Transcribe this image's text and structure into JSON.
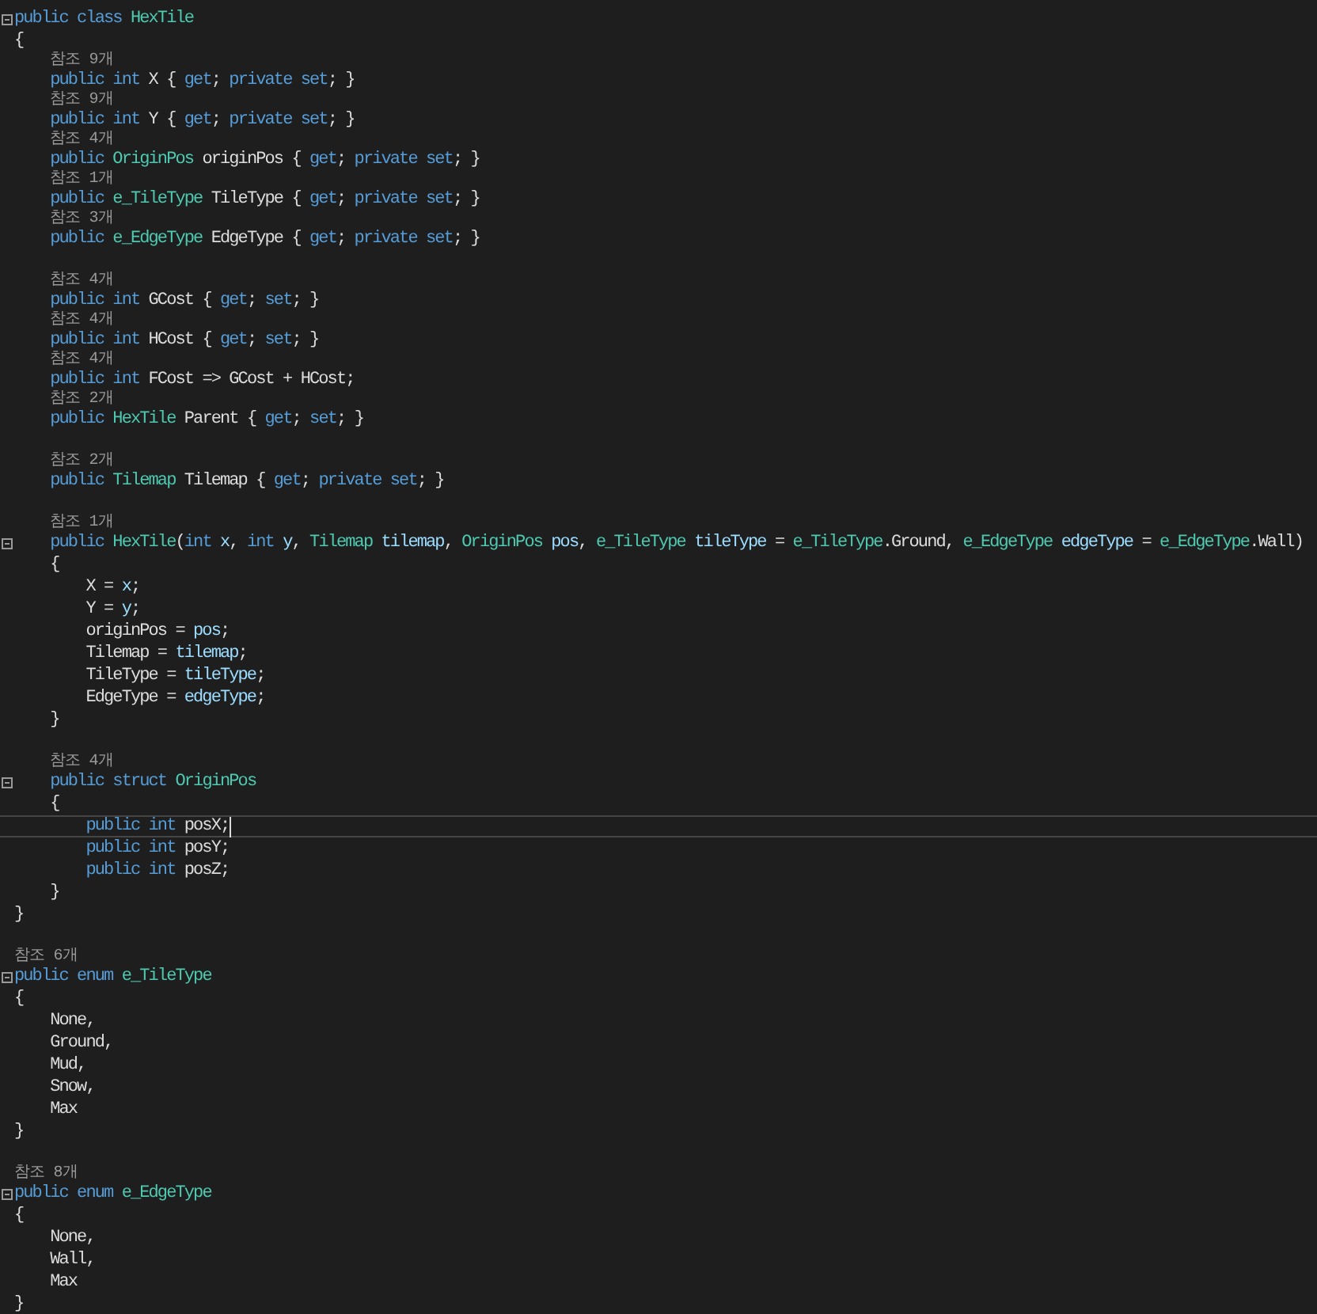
{
  "lines": [
    {
      "kind": "code",
      "fold": true,
      "tokens": [
        {
          "kind": "keyword",
          "text": "public class "
        },
        {
          "kind": "type",
          "text": "HexTile"
        }
      ]
    },
    {
      "kind": "code",
      "tokens": [
        {
          "kind": "plain",
          "text": "{"
        }
      ]
    },
    {
      "kind": "lens",
      "text": "    참조 9개"
    },
    {
      "kind": "code",
      "tokens": [
        {
          "kind": "keyword",
          "text": "    public int "
        },
        {
          "kind": "plain",
          "text": "X { "
        },
        {
          "kind": "keyword",
          "text": "get"
        },
        {
          "kind": "plain",
          "text": "; "
        },
        {
          "kind": "keyword",
          "text": "private set"
        },
        {
          "kind": "plain",
          "text": "; }"
        }
      ]
    },
    {
      "kind": "lens",
      "text": "    참조 9개"
    },
    {
      "kind": "code",
      "tokens": [
        {
          "kind": "keyword",
          "text": "    public int "
        },
        {
          "kind": "plain",
          "text": "Y { "
        },
        {
          "kind": "keyword",
          "text": "get"
        },
        {
          "kind": "plain",
          "text": "; "
        },
        {
          "kind": "keyword",
          "text": "private set"
        },
        {
          "kind": "plain",
          "text": "; }"
        }
      ]
    },
    {
      "kind": "lens",
      "text": "    참조 4개"
    },
    {
      "kind": "code",
      "tokens": [
        {
          "kind": "keyword",
          "text": "    public "
        },
        {
          "kind": "type",
          "text": "OriginPos "
        },
        {
          "kind": "plain",
          "text": "originPos { "
        },
        {
          "kind": "keyword",
          "text": "get"
        },
        {
          "kind": "plain",
          "text": "; "
        },
        {
          "kind": "keyword",
          "text": "private set"
        },
        {
          "kind": "plain",
          "text": "; }"
        }
      ]
    },
    {
      "kind": "lens",
      "text": "    참조 1개"
    },
    {
      "kind": "code",
      "tokens": [
        {
          "kind": "keyword",
          "text": "    public "
        },
        {
          "kind": "type",
          "text": "e_TileType "
        },
        {
          "kind": "plain",
          "text": "TileType { "
        },
        {
          "kind": "keyword",
          "text": "get"
        },
        {
          "kind": "plain",
          "text": "; "
        },
        {
          "kind": "keyword",
          "text": "private set"
        },
        {
          "kind": "plain",
          "text": "; }"
        }
      ]
    },
    {
      "kind": "lens",
      "text": "    참조 3개"
    },
    {
      "kind": "code",
      "tokens": [
        {
          "kind": "keyword",
          "text": "    public "
        },
        {
          "kind": "type",
          "text": "e_EdgeType "
        },
        {
          "kind": "plain",
          "text": "EdgeType { "
        },
        {
          "kind": "keyword",
          "text": "get"
        },
        {
          "kind": "plain",
          "text": "; "
        },
        {
          "kind": "keyword",
          "text": "private set"
        },
        {
          "kind": "plain",
          "text": "; }"
        }
      ]
    },
    {
      "kind": "blank"
    },
    {
      "kind": "lens",
      "text": "    참조 4개"
    },
    {
      "kind": "code",
      "tokens": [
        {
          "kind": "keyword",
          "text": "    public int "
        },
        {
          "kind": "plain",
          "text": "GCost { "
        },
        {
          "kind": "keyword",
          "text": "get"
        },
        {
          "kind": "plain",
          "text": "; "
        },
        {
          "kind": "keyword",
          "text": "set"
        },
        {
          "kind": "plain",
          "text": "; }"
        }
      ]
    },
    {
      "kind": "lens",
      "text": "    참조 4개"
    },
    {
      "kind": "code",
      "tokens": [
        {
          "kind": "keyword",
          "text": "    public int "
        },
        {
          "kind": "plain",
          "text": "HCost { "
        },
        {
          "kind": "keyword",
          "text": "get"
        },
        {
          "kind": "plain",
          "text": "; "
        },
        {
          "kind": "keyword",
          "text": "set"
        },
        {
          "kind": "plain",
          "text": "; }"
        }
      ]
    },
    {
      "kind": "lens",
      "text": "    참조 4개"
    },
    {
      "kind": "code",
      "tokens": [
        {
          "kind": "keyword",
          "text": "    public int "
        },
        {
          "kind": "plain",
          "text": "FCost => GCost + HCost;"
        }
      ]
    },
    {
      "kind": "lens",
      "text": "    참조 2개"
    },
    {
      "kind": "code",
      "tokens": [
        {
          "kind": "keyword",
          "text": "    public "
        },
        {
          "kind": "type",
          "text": "HexTile "
        },
        {
          "kind": "plain",
          "text": "Parent { "
        },
        {
          "kind": "keyword",
          "text": "get"
        },
        {
          "kind": "plain",
          "text": "; "
        },
        {
          "kind": "keyword",
          "text": "set"
        },
        {
          "kind": "plain",
          "text": "; }"
        }
      ]
    },
    {
      "kind": "blank"
    },
    {
      "kind": "lens",
      "text": "    참조 2개"
    },
    {
      "kind": "code",
      "tokens": [
        {
          "kind": "keyword",
          "text": "    public "
        },
        {
          "kind": "type",
          "text": "Tilemap "
        },
        {
          "kind": "plain",
          "text": "Tilemap { "
        },
        {
          "kind": "keyword",
          "text": "get"
        },
        {
          "kind": "plain",
          "text": "; "
        },
        {
          "kind": "keyword",
          "text": "private set"
        },
        {
          "kind": "plain",
          "text": "; }"
        }
      ]
    },
    {
      "kind": "blank"
    },
    {
      "kind": "lens",
      "text": "    참조 1개"
    },
    {
      "kind": "code",
      "fold": true,
      "tokens": [
        {
          "kind": "keyword",
          "text": "    public "
        },
        {
          "kind": "type",
          "text": "HexTile"
        },
        {
          "kind": "plain",
          "text": "("
        },
        {
          "kind": "keyword",
          "text": "int "
        },
        {
          "kind": "param",
          "text": "x"
        },
        {
          "kind": "plain",
          "text": ", "
        },
        {
          "kind": "keyword",
          "text": "int "
        },
        {
          "kind": "param",
          "text": "y"
        },
        {
          "kind": "plain",
          "text": ", "
        },
        {
          "kind": "type",
          "text": "Tilemap "
        },
        {
          "kind": "param",
          "text": "tilemap"
        },
        {
          "kind": "plain",
          "text": ", "
        },
        {
          "kind": "type",
          "text": "OriginPos "
        },
        {
          "kind": "param",
          "text": "pos"
        },
        {
          "kind": "plain",
          "text": ", "
        },
        {
          "kind": "type",
          "text": "e_TileType "
        },
        {
          "kind": "param",
          "text": "tileType"
        },
        {
          "kind": "plain",
          "text": " = "
        },
        {
          "kind": "type",
          "text": "e_TileType"
        },
        {
          "kind": "plain",
          "text": ".Ground, "
        },
        {
          "kind": "type",
          "text": "e_EdgeType "
        },
        {
          "kind": "param",
          "text": "edgeType"
        },
        {
          "kind": "plain",
          "text": " = "
        },
        {
          "kind": "type",
          "text": "e_EdgeType"
        },
        {
          "kind": "plain",
          "text": ".Wall)"
        }
      ]
    },
    {
      "kind": "code",
      "tokens": [
        {
          "kind": "plain",
          "text": "    {"
        }
      ]
    },
    {
      "kind": "code",
      "tokens": [
        {
          "kind": "plain",
          "text": "        X = "
        },
        {
          "kind": "param",
          "text": "x"
        },
        {
          "kind": "plain",
          "text": ";"
        }
      ]
    },
    {
      "kind": "code",
      "tokens": [
        {
          "kind": "plain",
          "text": "        Y = "
        },
        {
          "kind": "param",
          "text": "y"
        },
        {
          "kind": "plain",
          "text": ";"
        }
      ]
    },
    {
      "kind": "code",
      "tokens": [
        {
          "kind": "plain",
          "text": "        originPos = "
        },
        {
          "kind": "param",
          "text": "pos"
        },
        {
          "kind": "plain",
          "text": ";"
        }
      ]
    },
    {
      "kind": "code",
      "tokens": [
        {
          "kind": "plain",
          "text": "        Tilemap = "
        },
        {
          "kind": "param",
          "text": "tilemap"
        },
        {
          "kind": "plain",
          "text": ";"
        }
      ]
    },
    {
      "kind": "code",
      "tokens": [
        {
          "kind": "plain",
          "text": "        TileType = "
        },
        {
          "kind": "param",
          "text": "tileType"
        },
        {
          "kind": "plain",
          "text": ";"
        }
      ]
    },
    {
      "kind": "code",
      "tokens": [
        {
          "kind": "plain",
          "text": "        EdgeType = "
        },
        {
          "kind": "param",
          "text": "edgeType"
        },
        {
          "kind": "plain",
          "text": ";"
        }
      ]
    },
    {
      "kind": "code",
      "tokens": [
        {
          "kind": "plain",
          "text": "    }"
        }
      ]
    },
    {
      "kind": "blank"
    },
    {
      "kind": "lens",
      "text": "    참조 4개"
    },
    {
      "kind": "code",
      "fold": true,
      "tokens": [
        {
          "kind": "keyword",
          "text": "    public struct "
        },
        {
          "kind": "type",
          "text": "OriginPos"
        }
      ]
    },
    {
      "kind": "code",
      "tokens": [
        {
          "kind": "plain",
          "text": "    {"
        }
      ]
    },
    {
      "kind": "code",
      "current": true,
      "tokens": [
        {
          "kind": "keyword",
          "text": "        public int "
        },
        {
          "kind": "plain",
          "text": "posX;"
        }
      ]
    },
    {
      "kind": "code",
      "tokens": [
        {
          "kind": "keyword",
          "text": "        public int "
        },
        {
          "kind": "plain",
          "text": "posY;"
        }
      ]
    },
    {
      "kind": "code",
      "tokens": [
        {
          "kind": "keyword",
          "text": "        public int "
        },
        {
          "kind": "plain",
          "text": "posZ;"
        }
      ]
    },
    {
      "kind": "code",
      "tokens": [
        {
          "kind": "plain",
          "text": "    }"
        }
      ]
    },
    {
      "kind": "code",
      "tokens": [
        {
          "kind": "plain",
          "text": "}"
        }
      ]
    },
    {
      "kind": "blank"
    },
    {
      "kind": "lens",
      "text": "참조 6개"
    },
    {
      "kind": "code",
      "fold": true,
      "tokens": [
        {
          "kind": "keyword",
          "text": "public enum "
        },
        {
          "kind": "type",
          "text": "e_TileType"
        }
      ]
    },
    {
      "kind": "code",
      "tokens": [
        {
          "kind": "plain",
          "text": "{"
        }
      ]
    },
    {
      "kind": "code",
      "tokens": [
        {
          "kind": "plain",
          "text": "    None,"
        }
      ]
    },
    {
      "kind": "code",
      "tokens": [
        {
          "kind": "plain",
          "text": "    Ground,"
        }
      ]
    },
    {
      "kind": "code",
      "tokens": [
        {
          "kind": "plain",
          "text": "    Mud,"
        }
      ]
    },
    {
      "kind": "code",
      "tokens": [
        {
          "kind": "plain",
          "text": "    Snow,"
        }
      ]
    },
    {
      "kind": "code",
      "tokens": [
        {
          "kind": "plain",
          "text": "    Max"
        }
      ]
    },
    {
      "kind": "code",
      "tokens": [
        {
          "kind": "plain",
          "text": "}"
        }
      ]
    },
    {
      "kind": "blank"
    },
    {
      "kind": "lens",
      "text": "참조 8개"
    },
    {
      "kind": "code",
      "fold": true,
      "tokens": [
        {
          "kind": "keyword",
          "text": "public enum "
        },
        {
          "kind": "type",
          "text": "e_EdgeType"
        }
      ]
    },
    {
      "kind": "code",
      "tokens": [
        {
          "kind": "plain",
          "text": "{"
        }
      ]
    },
    {
      "kind": "code",
      "tokens": [
        {
          "kind": "plain",
          "text": "    None,"
        }
      ]
    },
    {
      "kind": "code",
      "tokens": [
        {
          "kind": "plain",
          "text": "    Wall,"
        }
      ]
    },
    {
      "kind": "code",
      "tokens": [
        {
          "kind": "plain",
          "text": "    Max"
        }
      ]
    },
    {
      "kind": "code",
      "tokens": [
        {
          "kind": "plain",
          "text": "}"
        }
      ]
    }
  ]
}
